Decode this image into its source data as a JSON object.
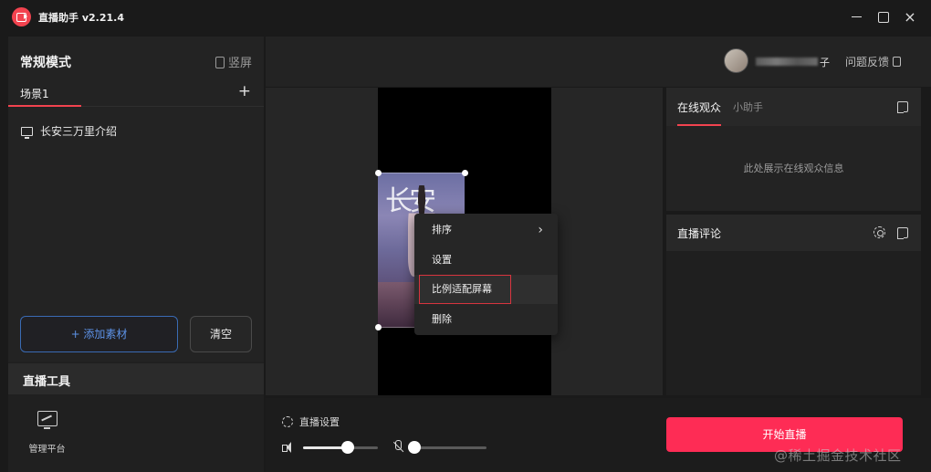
{
  "window": {
    "app_title": "直播助手 v2.21.4",
    "close_glyph": "×"
  },
  "left_panel": {
    "mode_title": "常规模式",
    "portrait_toggle_label": "竖屏",
    "scene_tab": "场景1",
    "scene_add": "+",
    "materials": [
      {
        "label": "长安三万里介绍",
        "icon": "monitor-icon"
      }
    ],
    "add_material_label": "+ 添加素材",
    "clear_label": "清空",
    "tools_title": "直播工具",
    "management_label": "管理平台"
  },
  "header": {
    "user_name_suffix": "子",
    "feedback_label": "问题反馈"
  },
  "preview": {
    "poster_text": "长安",
    "context_menu": {
      "items": [
        {
          "label": "排序",
          "has_submenu": true,
          "chevron": "›"
        },
        {
          "label": "设置",
          "has_submenu": false
        },
        {
          "label": "比例适配屏幕",
          "has_submenu": false,
          "highlighted": true
        },
        {
          "label": "删除",
          "has_submenu": false
        }
      ]
    }
  },
  "audience_panel": {
    "tab_active": "在线观众",
    "tab_inactive": "小助手",
    "empty_text": "此处展示在线观众信息"
  },
  "comments_panel": {
    "title": "直播评论"
  },
  "bottom_bar": {
    "live_settings_label": "直播设置",
    "volume_level": 0.6,
    "mic_level": 0.0,
    "start_button_label": "开始直播"
  },
  "watermark": "@稀土掘金技术社区",
  "colors": {
    "accent": "#fe2c55",
    "tab_indicator": "#f2434f",
    "add_material_border": "#3a6bb4",
    "add_material_text": "#5d92e6"
  }
}
